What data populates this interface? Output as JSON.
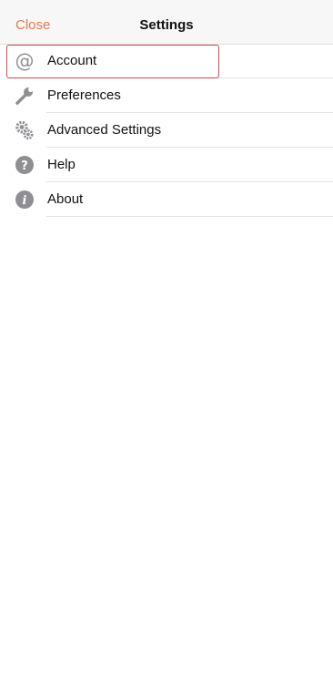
{
  "colors": {
    "accent": "#e07a52",
    "icon_gray": "#8e8e93",
    "highlight": "#d9434e",
    "navbar_bg": "#f7f7f7"
  },
  "header": {
    "close_label": "Close",
    "title": "Settings"
  },
  "menu": {
    "items": [
      {
        "label": "Account",
        "icon": "at-sign-icon"
      },
      {
        "label": "Preferences",
        "icon": "wrench-icon"
      },
      {
        "label": "Advanced Settings",
        "icon": "gears-icon"
      },
      {
        "label": "Help",
        "icon": "help-circle-icon"
      },
      {
        "label": "About",
        "icon": "info-circle-icon"
      }
    ],
    "selected_index": 0
  }
}
